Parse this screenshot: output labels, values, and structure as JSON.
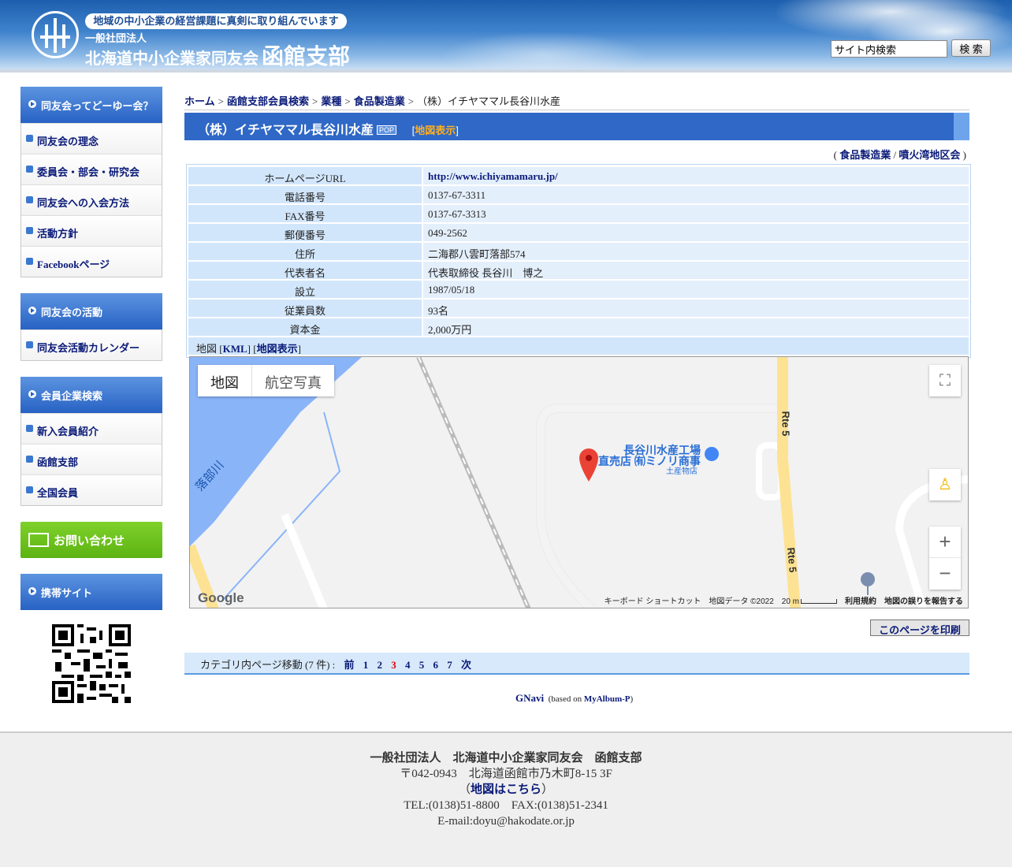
{
  "header": {
    "tagline": "地域の中小企業の経営課題に真剣に取り組んでいます",
    "org_type": "一般社団法人",
    "org_name": "北海道中小企業家同友会",
    "branch": "函館支部",
    "search_placeholder": "サイト内検索",
    "search_button": "検 索"
  },
  "sidebar": {
    "section1": {
      "title": "同友会ってどーゆー会？",
      "items": [
        "同友会の理念",
        "委員会・部会・研究会",
        "同友会への入会方法",
        "活動方針",
        "Facebookページ"
      ]
    },
    "section2": {
      "title": "同友会の活動",
      "items": [
        "同友会活動カレンダー"
      ]
    },
    "section3": {
      "title": "会員企業検索",
      "items": [
        "新入会員紹介",
        "函館支部",
        "全国会員"
      ]
    },
    "contact": "お問い合わせ",
    "mobile": "携帯サイト"
  },
  "breadcrumb": {
    "items": [
      "ホーム",
      "函館支部会員検索",
      "業種",
      "食品製造業"
    ],
    "current": "（株）イチヤママル長谷川水産",
    "sep": ">"
  },
  "title": {
    "text": "（株）イチヤママル長谷川水産",
    "pop": "POP",
    "map_link": "地図表示"
  },
  "categories": {
    "open": "(",
    "cat1": "食品製造業",
    "slash": "/",
    "cat2": "噴火湾地区会",
    "close": ")"
  },
  "info": [
    {
      "k": "ホームページURL",
      "v": "http://www.ichiyamamaru.jp/"
    },
    {
      "k": "電話番号",
      "v": "0137-67-3311"
    },
    {
      "k": "FAX番号",
      "v": "0137-67-3313"
    },
    {
      "k": "郵便番号",
      "v": "049-2562"
    },
    {
      "k": "住所",
      "v": "二海郡八雲町落部574"
    },
    {
      "k": "代表者名",
      "v": "代表取締役 長谷川　博之"
    },
    {
      "k": "設立",
      "v": "1987/05/18"
    },
    {
      "k": "従業員数",
      "v": "93名"
    },
    {
      "k": "資本金",
      "v": "2,000万円"
    }
  ],
  "maprow": {
    "label": "地図",
    "kml": "KML",
    "show": "地図表示"
  },
  "map": {
    "tab_map": "地図",
    "tab_sat": "航空写真",
    "river": "落部川",
    "road1": "Rte 5",
    "road2": "Rte 5",
    "poi1": "長谷川水産工場",
    "poi2": "直売店 ㈲ミノリ商事",
    "poi3": "土産物店",
    "logo": "Google",
    "kbd": "キーボード ショートカット",
    "data": "地図データ ©2022",
    "scale": "20 m",
    "terms": "利用規約",
    "report": "地図の誤りを報告する"
  },
  "print": "このページを印刷",
  "pager": {
    "label": "カテゴリ内ページ移動 (7 件) :",
    "prev": "前",
    "pages": [
      "1",
      "2",
      "3",
      "4",
      "5",
      "6",
      "7"
    ],
    "current": "3",
    "next": "次"
  },
  "gnavi": {
    "name": "GNavi",
    "based": "(based on",
    "album": "MyAlbum-P",
    "close": ")"
  },
  "footer": {
    "name": "一般社団法人　北海道中小企業家同友会　函館支部",
    "address": "〒042-0943　北海道函館市乃木町8-15 3F",
    "map_open": "（",
    "map": "地図はこちら",
    "map_close": "）",
    "tel": "TEL:(0138)51-8800　FAX:(0138)51-2341",
    "email": "E-mail:doyu@hakodate.or.jp"
  }
}
